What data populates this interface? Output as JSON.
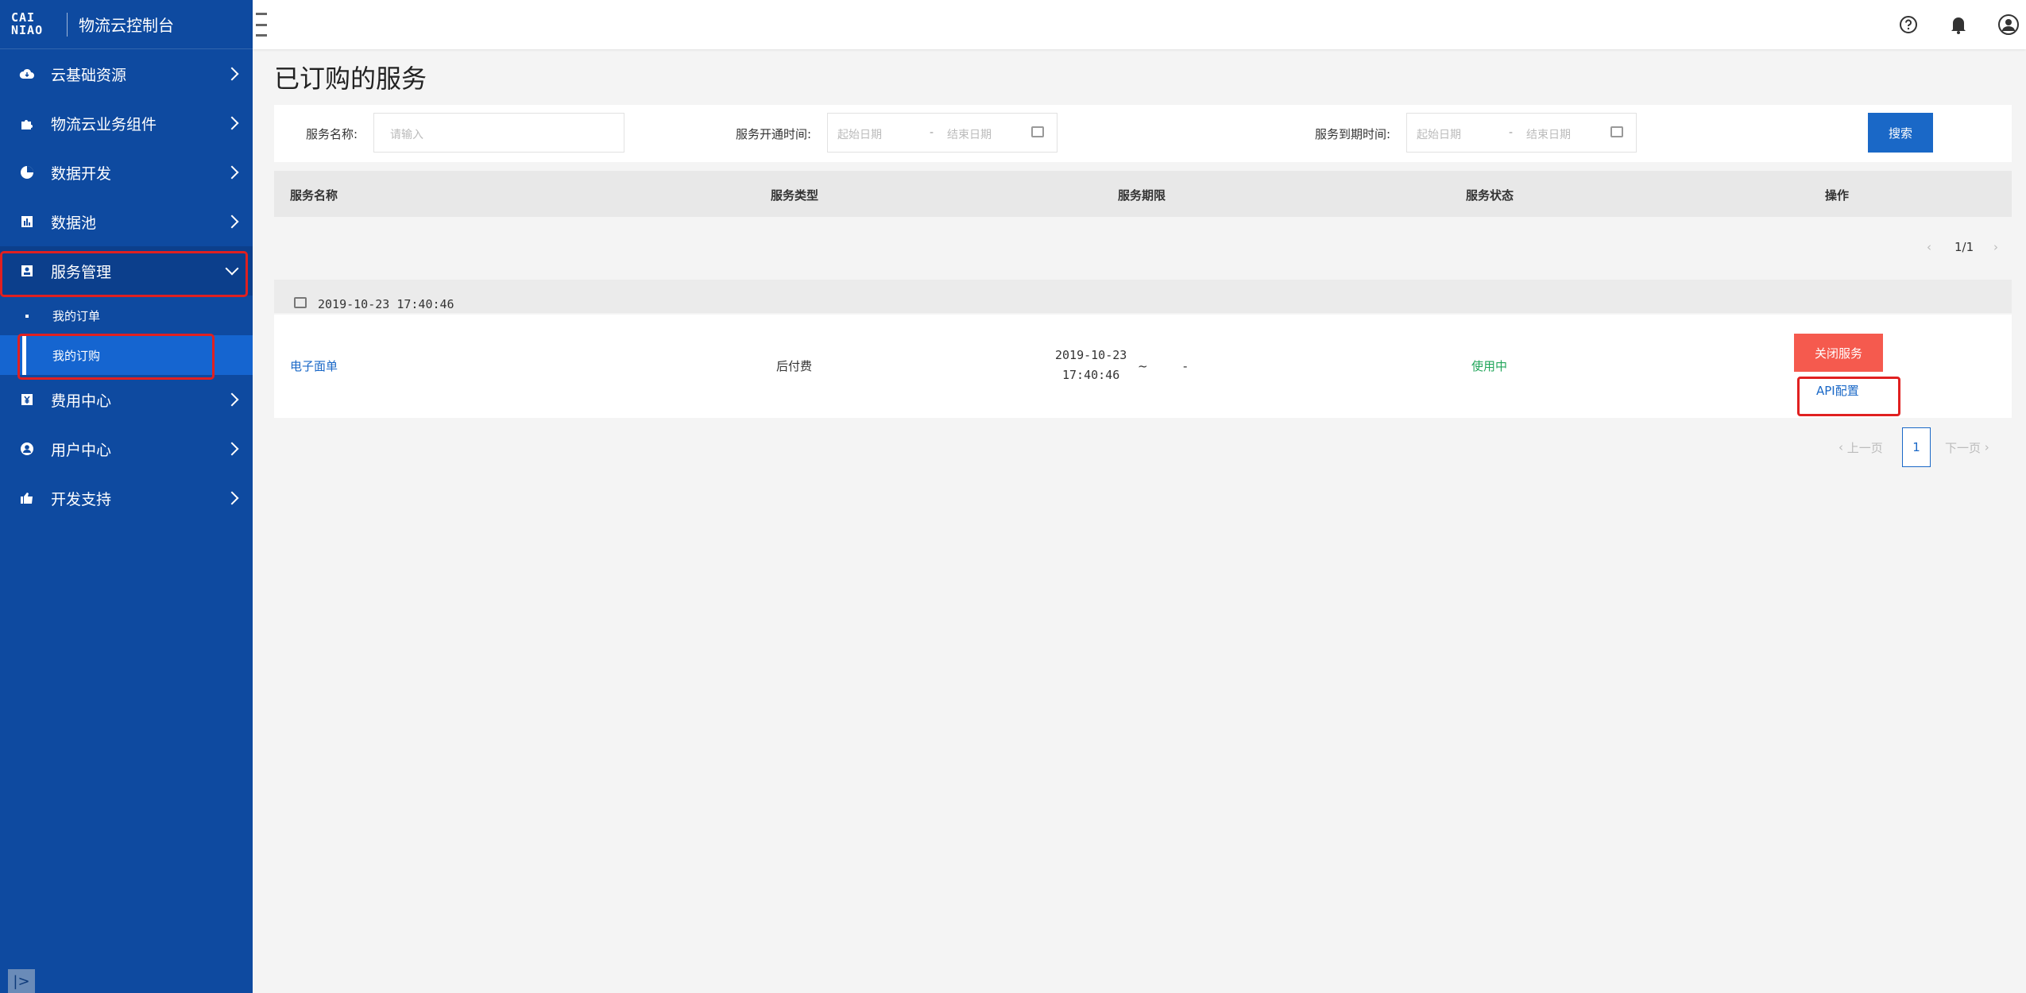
{
  "brand": {
    "logo_text": "CAI NIAO",
    "title": "物流云控制台"
  },
  "sidebar": {
    "items": [
      {
        "label": "云基础资源",
        "icon": "cloud-icon"
      },
      {
        "label": "物流云业务组件",
        "icon": "puzzle-icon"
      },
      {
        "label": "数据开发",
        "icon": "pie-chart-icon"
      },
      {
        "label": "数据池",
        "icon": "bar-chart-icon"
      },
      {
        "label": "服务管理",
        "icon": "service-icon",
        "expanded": true
      },
      {
        "label": "费用中心",
        "icon": "yen-icon"
      },
      {
        "label": "用户中心",
        "icon": "user-icon"
      },
      {
        "label": "开发支持",
        "icon": "thumb-icon"
      }
    ],
    "sub_items": [
      {
        "label": "我的订单",
        "active": false
      },
      {
        "label": "我的订购",
        "active": true
      }
    ],
    "toggle_glyph": "|>"
  },
  "topbar": {
    "icons": [
      "help-icon",
      "bell-icon",
      "user-avatar-icon"
    ]
  },
  "page": {
    "title": "已订购的服务"
  },
  "filter": {
    "name_label": "服务名称:",
    "name_placeholder": "请输入",
    "open_time_label": "服务开通时间:",
    "expire_time_label": "服务到期时间:",
    "start_placeholder": "起始日期",
    "end_placeholder": "结束日期",
    "range_sep": "-",
    "search_label": "搜索"
  },
  "table": {
    "headers": [
      "服务名称",
      "服务类型",
      "服务期限",
      "服务状态",
      "操作"
    ],
    "mini_pager": "1/1",
    "group_date": "2019-10-23 17:40:46",
    "rows": [
      {
        "name": "电子面单",
        "type": "后付费",
        "term_start_date": "2019-10-23",
        "term_start_time": "17:40:46",
        "term_sep": "~",
        "term_end": "-",
        "status": "使用中",
        "action_primary": "关闭服务",
        "action_link": "API配置"
      }
    ]
  },
  "pager": {
    "prev": "上一页",
    "current": "1",
    "next": "下一页",
    "prev_arrow": "‹",
    "next_arrow": "›"
  },
  "colors": {
    "sidebar": "#0e4aa0",
    "accent": "#1a68c7",
    "danger": "#f55a4e",
    "success": "#21a55a",
    "highlight": "#e02020"
  }
}
